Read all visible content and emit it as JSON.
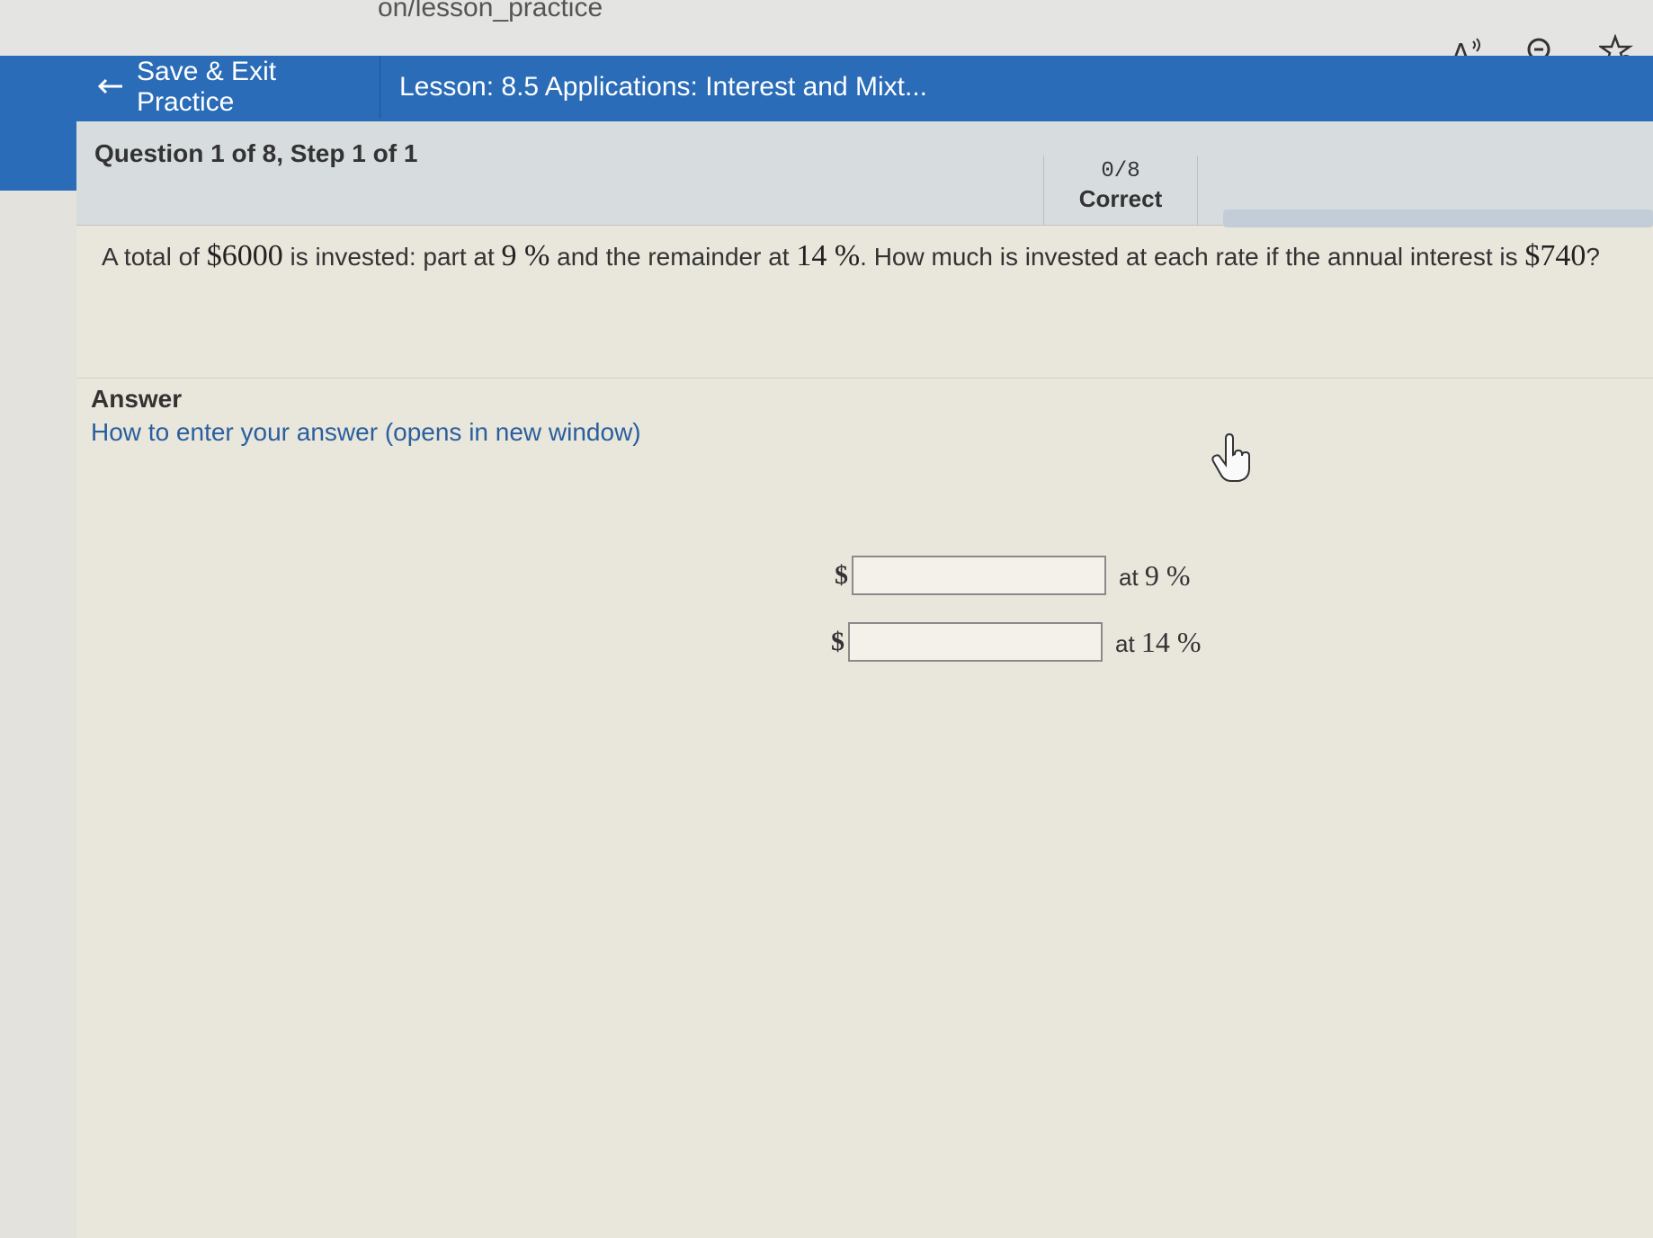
{
  "browser": {
    "url_fragment": "on/lesson_practice",
    "actions": [
      {
        "name": "read-aloud-icon",
        "glyph": "A⁾"
      },
      {
        "name": "zoom-icon",
        "glyph": "⊖"
      },
      {
        "name": "favorite-add-icon",
        "glyph": "☆"
      }
    ]
  },
  "header": {
    "save_exit_label": "Save & Exit Practice",
    "lesson_title": "Lesson: 8.5 Applications: Interest and Mixt..."
  },
  "question": {
    "label": "Question 1 of 8, Step 1 of 1",
    "score": "0/8",
    "score_label": "Correct",
    "progress_fraction": 0
  },
  "problem": {
    "part1": "A total of ",
    "total": "$6000",
    "part2": " is invested: part at ",
    "rate1": "9 %",
    "part3": "  and the remainder at ",
    "rate2": "14 %",
    "part4": ". How much is invested at each rate if the annual interest is ",
    "interest": "$740",
    "part5": "?"
  },
  "answer": {
    "label": "Answer",
    "help_link": "How to enter your answer (opens in new window)",
    "rows": [
      {
        "currency": "$",
        "value": "",
        "rate_prefix": "at ",
        "rate": "9 %"
      },
      {
        "currency": "$",
        "value": "",
        "rate_prefix": "at ",
        "rate": "14 %"
      }
    ]
  },
  "colors": {
    "header_blue": "#2a6cb8",
    "link_blue": "#2a5f9e"
  }
}
